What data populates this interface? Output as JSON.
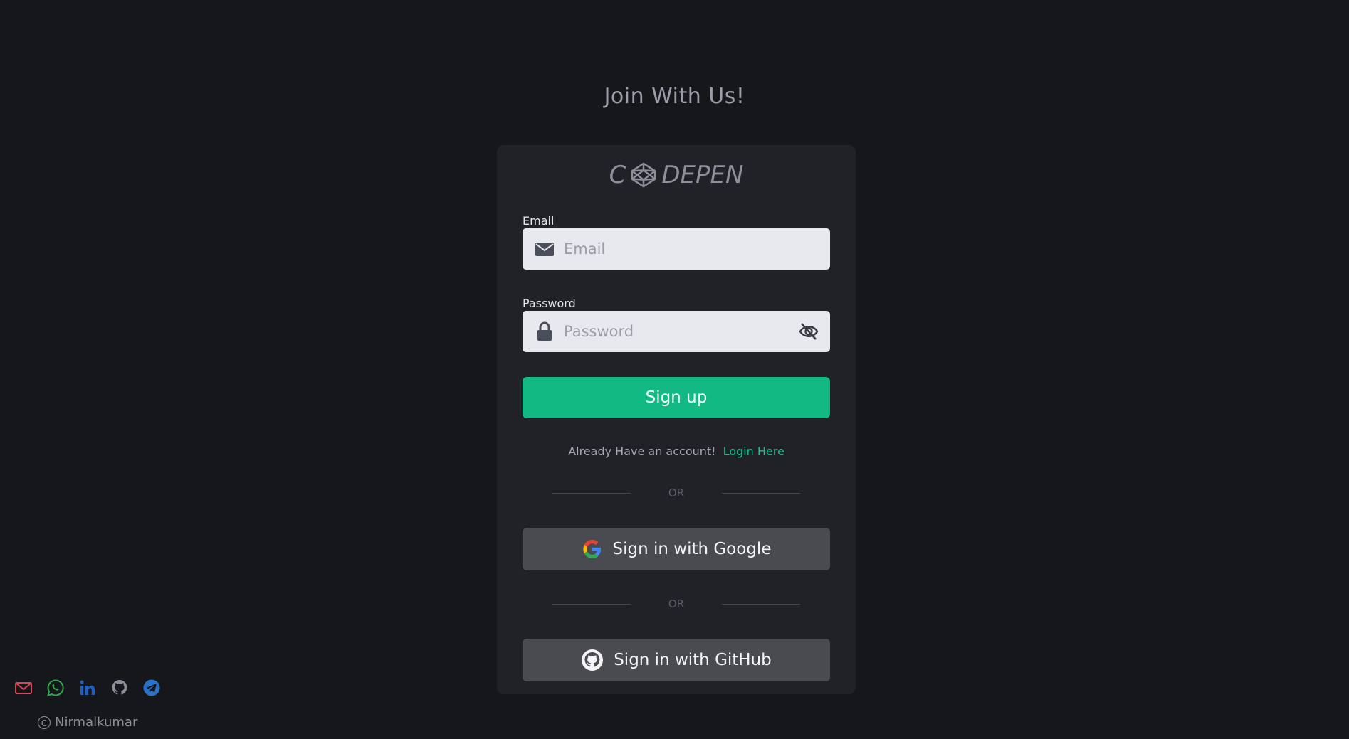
{
  "page": {
    "heading": "Join With Us!"
  },
  "logo": {
    "prefix": "C",
    "suffix": "DEPEN"
  },
  "form": {
    "email": {
      "label": "Email",
      "placeholder": "Email",
      "value": ""
    },
    "password": {
      "label": "Password",
      "placeholder": "Password",
      "value": ""
    },
    "signup_label": "Sign up",
    "account_prompt": "Already Have an account!",
    "login_link": "Login Here",
    "or_text_1": "OR",
    "or_text_2": "OR",
    "google_label": "Sign in with Google",
    "github_label": "Sign in with GitHub"
  },
  "footer": {
    "social_icons": [
      "mail-icon",
      "whatsapp-icon",
      "linkedin-icon",
      "github-icon",
      "telegram-icon"
    ],
    "copyright_name": "Nirmalkumar"
  },
  "colors": {
    "background": "#16171b",
    "card": "#212228",
    "accent": "#12b983",
    "social_button": "#4a4b50"
  }
}
